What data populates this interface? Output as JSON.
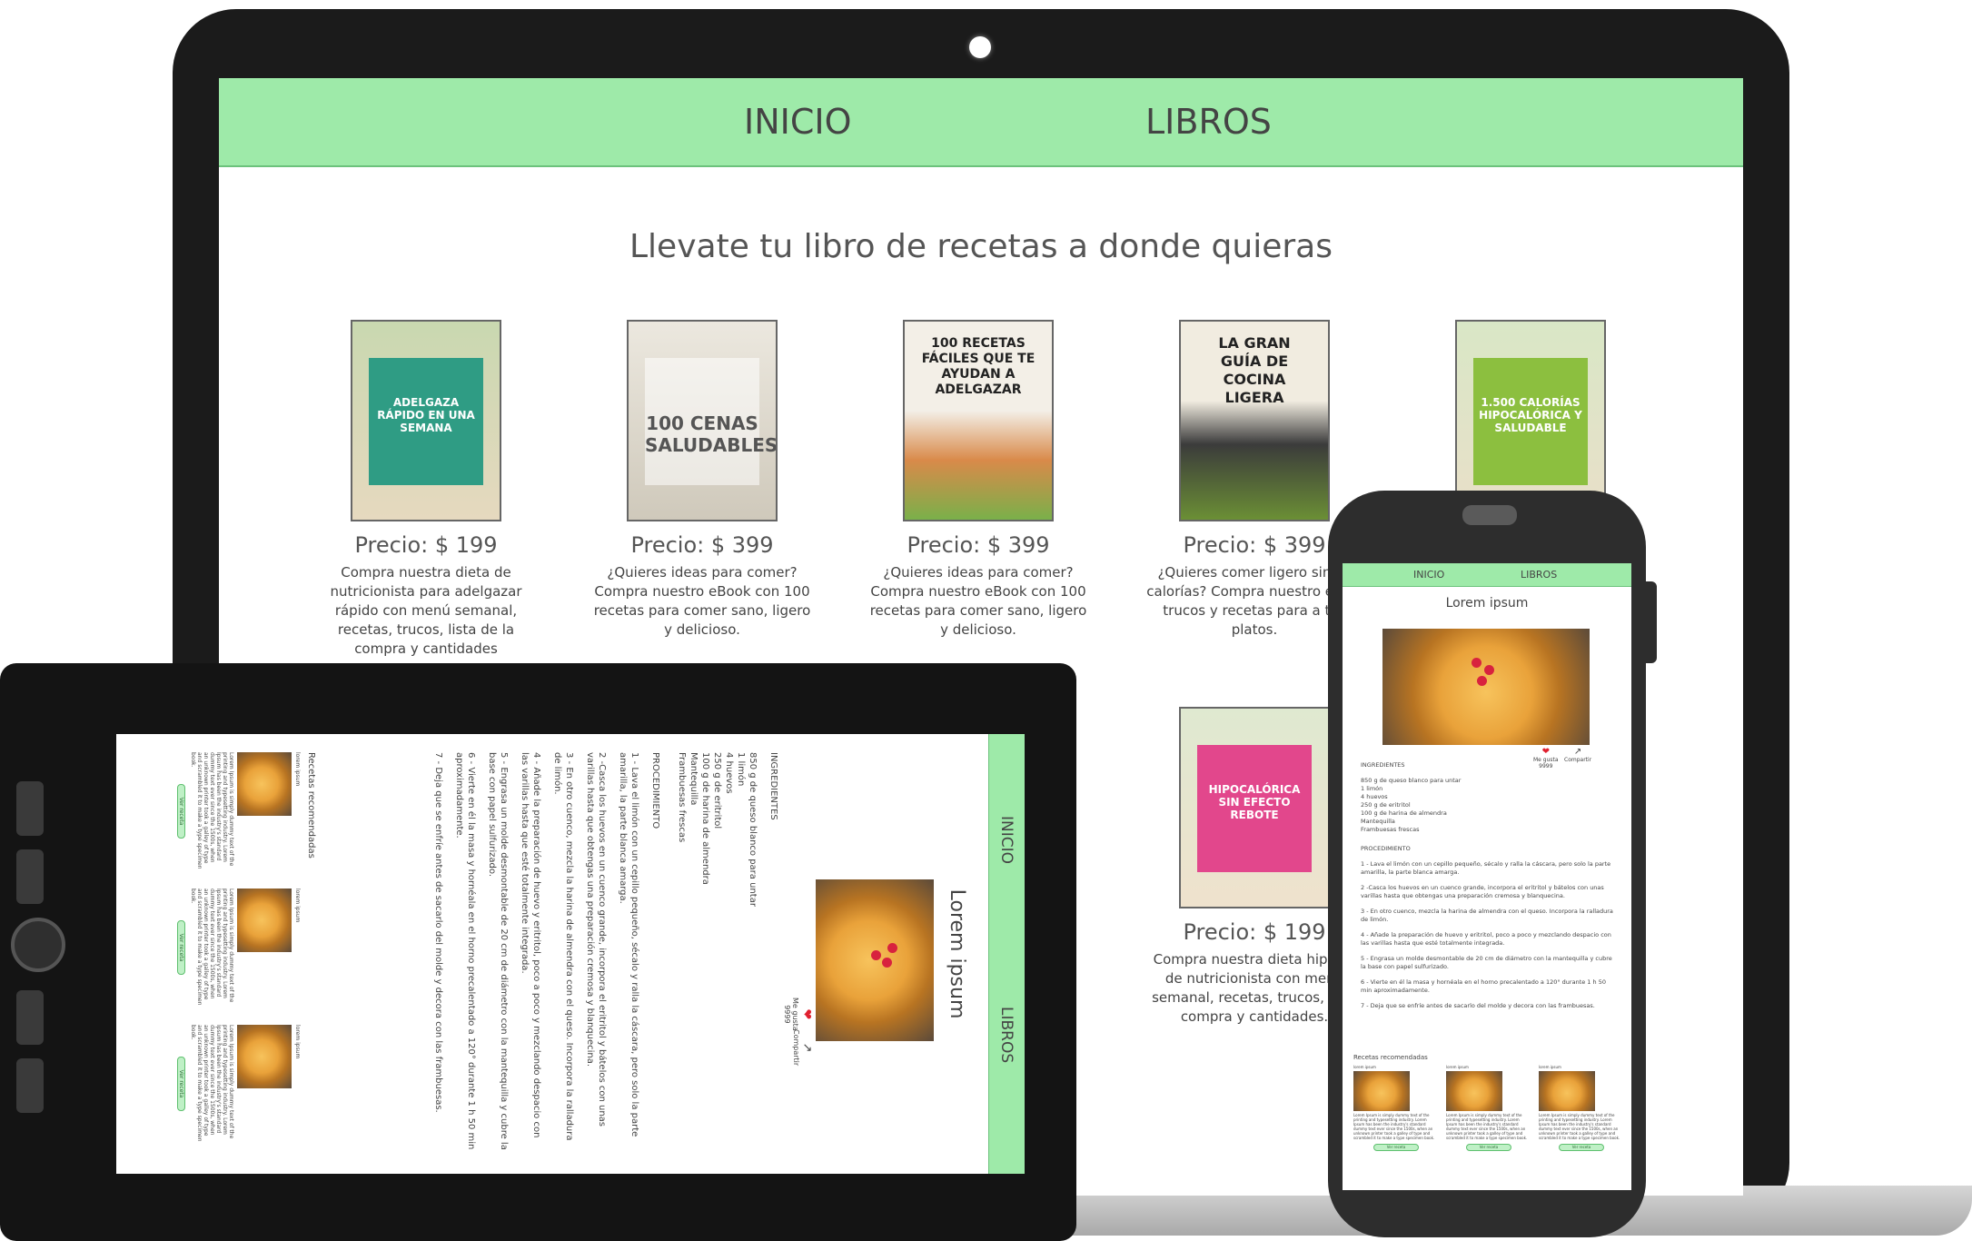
{
  "laptop": {
    "nav": {
      "inicio": "INICIO",
      "libros": "LIBROS"
    },
    "heading": "Llevate tu libro de recetas a donde quieras",
    "books": [
      {
        "price": "Precio: $ 199",
        "desc": "Compra nuestra dieta de nutricionista para adelgazar rápido con menú semanal, recetas, trucos, lista de la compra y cantidades",
        "cover_text": "ADELGAZA RÁPIDO EN UNA SEMANA",
        "cover_color": "#2f9c84"
      },
      {
        "price": "Precio: $ 399",
        "desc": "¿Quieres ideas para comer? Compra nuestro eBook con 100 recetas para comer sano, ligero y delicioso.",
        "cover_text": "100 CENAS SALUDABLES",
        "cover_color": "#d9d4c6"
      },
      {
        "price": "Precio: $ 399",
        "desc": "¿Quieres ideas para comer? Compra nuestro eBook con 100 recetas para comer sano, ligero y delicioso.",
        "cover_text": "100 RECETAS FÁCILES QUE TE AYUDAN A ADELGAZAR",
        "cover_color": "#e8e4dc"
      },
      {
        "price": "Precio: $ 399",
        "desc": "¿Quieres comer ligero sin co calorías? Compra nuestro e con trucos y recetas para a tus platos.",
        "cover_text": "LA GRAN GUÍA DE COCINA LIGERA",
        "cover_color": "#efe9dc"
      },
      {
        "price": "",
        "desc": "",
        "cover_text": "1.500 CALORÍAS HIPOCALÓRICA Y SALUDABLE",
        "cover_color": "#8cbf3f"
      },
      {
        "price": "Precio: $ 199",
        "desc": "Compra nuestra dieta hipocal de nutricionista con menú semanal, recetas, trucos, lista compra y cantidades.",
        "cover_text": "HIPOCALÓRICA SIN EFECTO REBOTE",
        "cover_color": "#e2478c"
      }
    ]
  },
  "recipe": {
    "nav": {
      "inicio": "INICIO",
      "libros": "LIBROS"
    },
    "title": "Lorem ipsum",
    "like_label": "Me gusta",
    "like_count": "9999",
    "share_label": "Compartir",
    "ingredients_title": "INGREDIENTES",
    "ingredients": [
      "850 g de queso blanco para untar",
      "1 limón",
      "4 huevos",
      "250 g de eritritol",
      "100 g de harina de almendra",
      "Mantequilla",
      "Frambuesas frescas"
    ],
    "procedure_title": "PROCEDIMIENTO",
    "steps": [
      "1 - Lava el limón con un cepillo pequeño, sécalo y ralla la cáscara, pero solo la parte amarilla, la parte blanca amarga.",
      "2 -Casca los huevos en un cuenco grande, incorpora el eritritol y bátelos con unas varillas hasta que obtengas una preparación cremosa y blanquecina.",
      "3 - En otro cuenco, mezcla la harina de almendra con el queso. Incorpora la ralladura de limón.",
      "4 - Añade la preparación de huevo y eritritol, poco a poco y mezclando despacio con las varillas hasta que esté totalmente integrada.",
      "5 - Engrasa un molde desmontable de 20 cm de diámetro con la mantequilla y cubre la base con papel sulfurizado.",
      "6 - Vierte en él la masa y hornéala en el horno precalentado a 120° durante 1 h 50 min aproximadamente.",
      "7 - Deja que se enfríe antes de sacarlo del molde y decora con las frambuesas."
    ],
    "recommended_title": "Recetas recomendadas",
    "recommended": [
      {
        "title": "lorem ipsum",
        "text": "Lorem Ipsum is simply dummy text of the printing and typesetting industry. Lorem Ipsum has been the industry's standard dummy text ever since the 1500s, when an unknown printer took a galley of type and scrambled it to make a type specimen book.",
        "button": "Ver receta"
      },
      {
        "title": "lorem ipsum",
        "text": "Lorem Ipsum is simply dummy text of the printing and typesetting industry. Lorem Ipsum has been the industry's standard dummy text ever since the 1500s, when an unknown printer took a galley of type and scrambled it to make a type specimen book.",
        "button": "Ver receta"
      },
      {
        "title": "lorem ipsum",
        "text": "Lorem Ipsum is simply dummy text of the printing and typesetting industry. Lorem Ipsum has been the industry's standard dummy text ever since the 1500s, when an unknown printer took a galley of type and scrambled it to make a type specimen book.",
        "button": "Ver receta"
      }
    ]
  },
  "colors": {
    "nav_green": "#9eeaa9",
    "heart_red": "#e0202f",
    "device_dark": "#1b1b1b"
  },
  "icons": {
    "like": "heart-icon",
    "share": "share-icon",
    "camera": "camera-icon"
  }
}
